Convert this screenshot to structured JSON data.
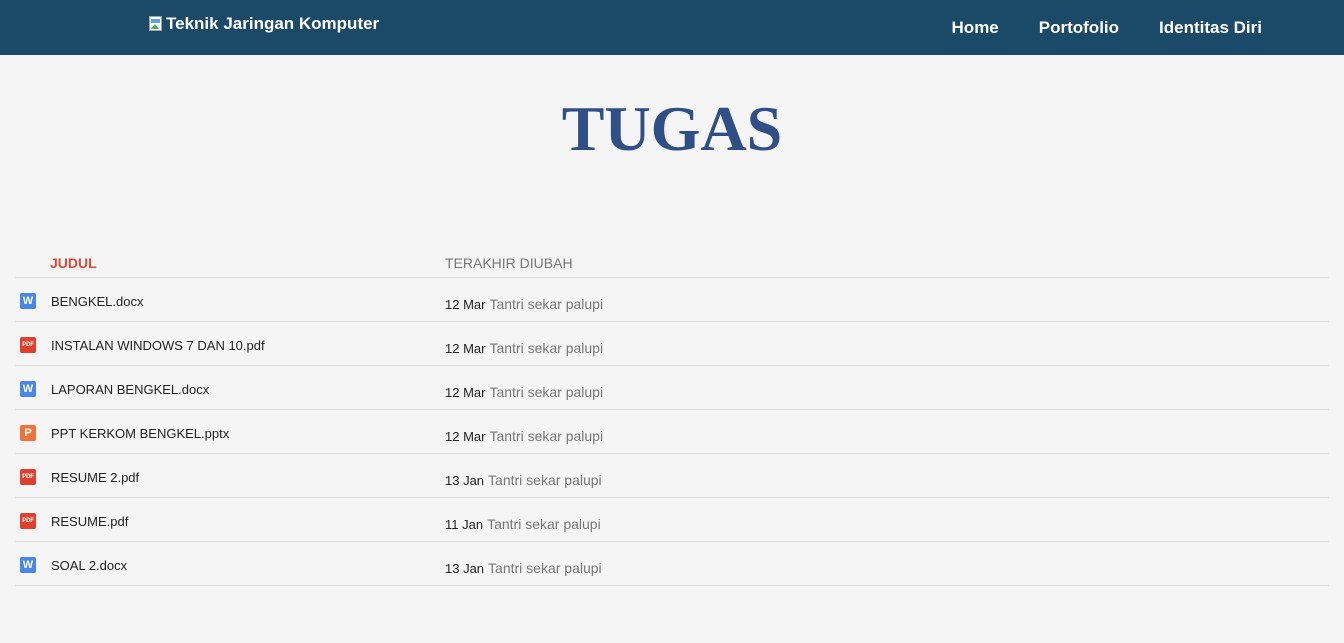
{
  "navbar": {
    "brand": "Teknik Jaringan Komputer",
    "links": [
      "Home",
      "Portofolio",
      "Identitas Diri"
    ],
    "bg_color": "#1b4a69"
  },
  "page": {
    "title": "TUGAS",
    "title_color": "#2f4f86"
  },
  "table": {
    "headers": {
      "title": "JUDUL",
      "modified": "TERAKHIR DIUBAH"
    },
    "rows": [
      {
        "icon": "word-doc-icon",
        "name": "BENGKEL.docx",
        "date": "12 Mar",
        "author": "Tantri sekar palupi"
      },
      {
        "icon": "pdf-icon",
        "name": "INSTALAN WINDOWS 7 DAN 10.pdf",
        "date": "12 Mar",
        "author": "Tantri sekar palupi"
      },
      {
        "icon": "word-doc-icon",
        "name": "LAPORAN BENGKEL.docx",
        "date": "12 Mar",
        "author": "Tantri sekar palupi"
      },
      {
        "icon": "powerpoint-icon",
        "name": "PPT KERKOM BENGKEL.pptx",
        "date": "12 Mar",
        "author": "Tantri sekar palupi"
      },
      {
        "icon": "pdf-icon",
        "name": "RESUME 2.pdf",
        "date": "13 Jan",
        "author": "Tantri sekar palupi"
      },
      {
        "icon": "pdf-icon",
        "name": "RESUME.pdf",
        "date": "11 Jan",
        "author": "Tantri sekar palupi"
      },
      {
        "icon": "word-doc-icon",
        "name": "SOAL 2.docx",
        "date": "13 Jan",
        "author": "Tantri sekar palupi"
      }
    ]
  },
  "icon_glyphs": {
    "word": "W",
    "pdf": "PDF",
    "ppt": "P"
  }
}
